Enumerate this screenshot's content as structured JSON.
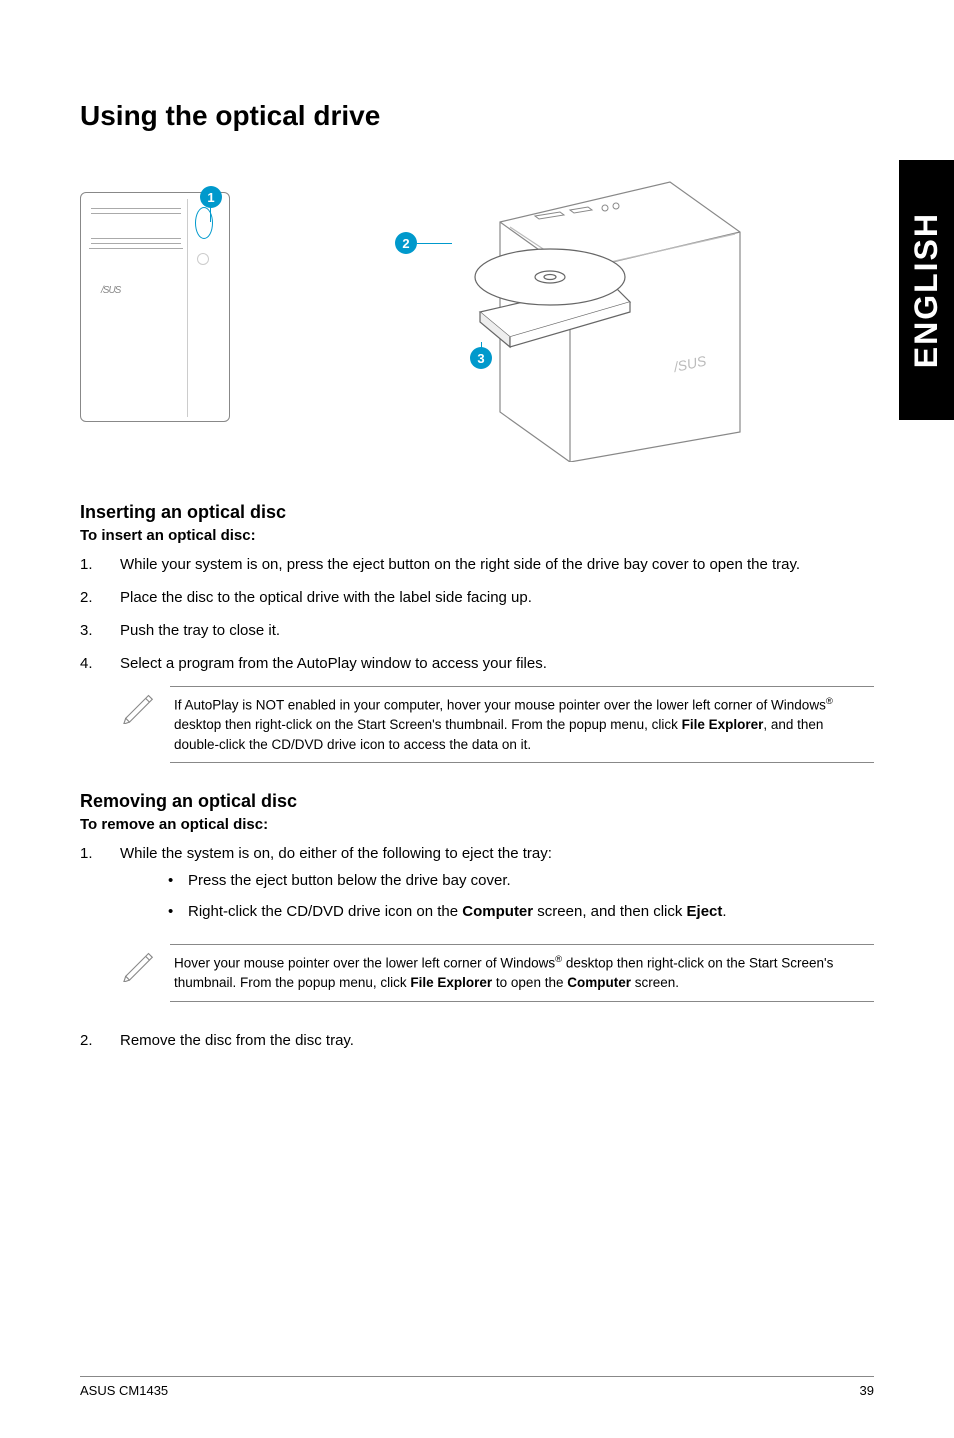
{
  "sideTab": "ENGLISH",
  "mainTitle": "Using the optical drive",
  "callout1": "1",
  "callout2": "2",
  "callout3": "3",
  "inserting": {
    "heading": "Inserting an optical disc",
    "sub": "To insert an optical disc:",
    "steps": [
      "While your system is on, press the eject button on the right side of the drive bay cover to open the tray.",
      "Place the disc to the optical drive with the label side facing up.",
      "Push the tray to close it.",
      "Select a program from the AutoPlay window to access your files."
    ],
    "note_pre": "If AutoPlay is NOT enabled in your computer, hover your mouse pointer over the lower left corner of Windows",
    "note_post": " desktop then right-click on the Start Screen's thumbnail. From the popup menu, click ",
    "note_bold": "File Explorer",
    "note_end": ", and then double-click the CD/DVD drive icon to access the data on it.",
    "reg": "®"
  },
  "removing": {
    "heading": "Removing an optical disc",
    "sub": "To remove an optical disc:",
    "step1": "While the system is on, do either of the following to eject the tray:",
    "bullet1": "Press the eject button below the drive bay cover.",
    "bullet2_pre": "Right-click the CD/DVD drive icon on the ",
    "bullet2_b1": "Computer",
    "bullet2_mid": " screen, and then click ",
    "bullet2_b2": "Eject",
    "bullet2_end": ".",
    "note_pre": "Hover your mouse pointer over the lower left corner of Windows",
    "note_post": " desktop then right-click on the Start Screen's thumbnail. From the popup menu, click ",
    "note_bold": "File Explorer",
    "note_mid": " to open the ",
    "note_bold2": "Computer",
    "note_end": " screen.",
    "reg": "®",
    "step2": "Remove the disc from the disc tray."
  },
  "footer": {
    "left": "ASUS CM1435",
    "right": "39"
  }
}
